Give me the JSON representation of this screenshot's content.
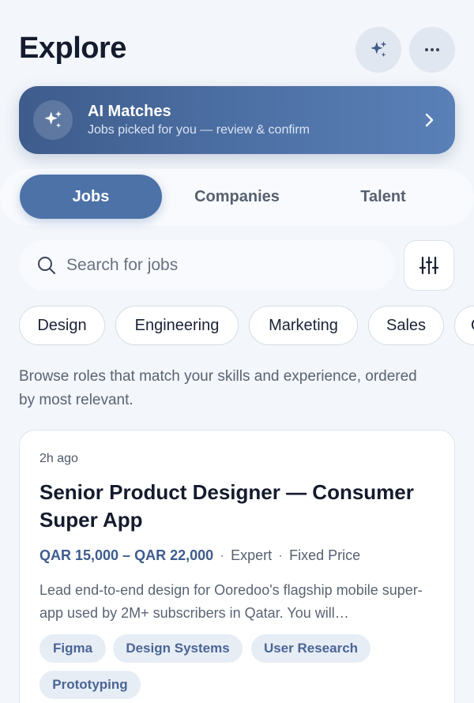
{
  "header": {
    "title": "Explore",
    "sparkle_icon": "sparkle-icon",
    "more_icon": "more-horizontal-icon"
  },
  "ai_banner": {
    "title": "AI Matches",
    "subtitle": "Jobs picked for you — review & confirm",
    "icon": "sparkle-icon",
    "chevron": "chevron-right-icon"
  },
  "tabs": [
    {
      "label": "Jobs",
      "active": true
    },
    {
      "label": "Companies",
      "active": false
    },
    {
      "label": "Talent",
      "active": false
    }
  ],
  "search": {
    "placeholder": "Search for jobs",
    "value": "",
    "filter_icon": "sliders-icon"
  },
  "filters": [
    "Design",
    "Engineering",
    "Marketing",
    "Sales",
    "Operations"
  ],
  "description": "Browse roles that match your skills and experience, ordered by most relevant.",
  "job": {
    "posted": "2h ago",
    "title": "Senior Product Designer — Consumer Super App",
    "salary": "QAR 15,000 – QAR 22,000",
    "level": "Expert",
    "contract": "Fixed Price",
    "summary": "Lead end-to-end design for Ooredoo's flagship mobile super-app used by 2M+ subscribers in Qatar. You will…",
    "tags": [
      "Figma",
      "Design Systems",
      "User Research",
      "Prototyping"
    ]
  },
  "colors": {
    "accent": "#4d72a8",
    "accent_dark": "#3e5c8c",
    "background": "#f3f6fa"
  }
}
